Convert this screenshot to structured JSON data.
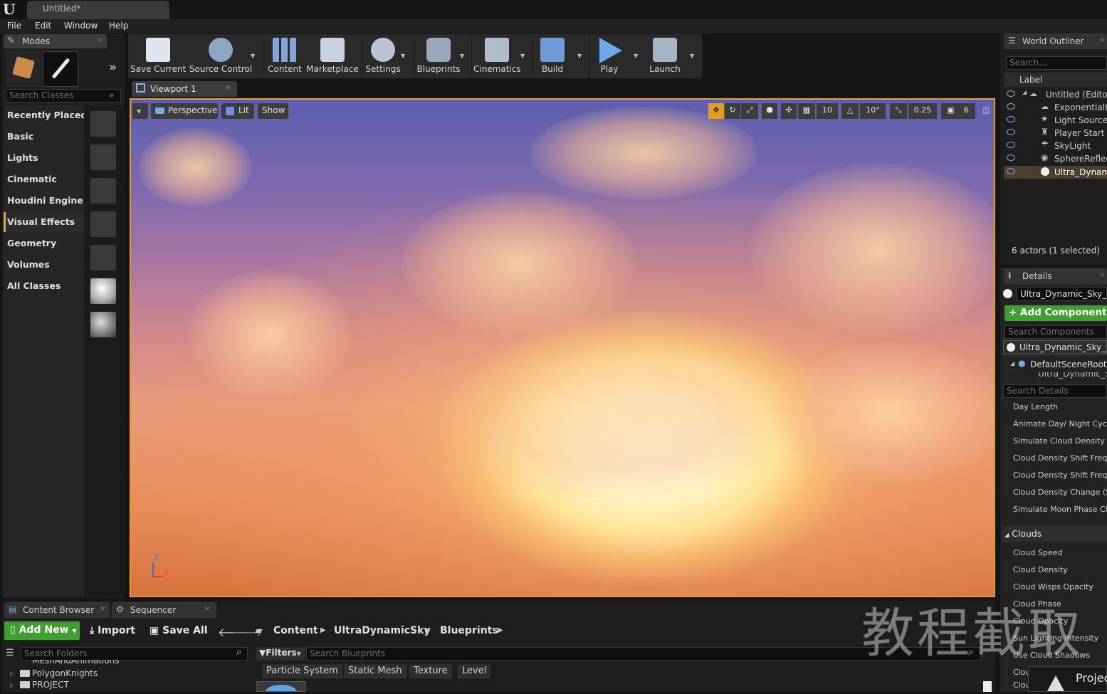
{
  "app": {
    "title": "Untitled*"
  },
  "menu": [
    "File",
    "Edit",
    "Window",
    "Help"
  ],
  "modes": {
    "tab": "Modes",
    "search_placeholder": "Search Classes",
    "categories": [
      "Recently Placed",
      "Basic",
      "Lights",
      "Cinematic",
      "Houdini Engine",
      "Visual Effects",
      "Geometry",
      "Volumes",
      "All Classes"
    ],
    "selected_category": "Visual Effects"
  },
  "toolbar": {
    "buttons": [
      "Save Current",
      "Source Control",
      "Content",
      "Marketplace",
      "Settings",
      "Blueprints",
      "Cinematics",
      "Build",
      "Play",
      "Launch"
    ]
  },
  "viewport": {
    "tab": "Viewport 1",
    "perspective": "Perspective",
    "lit": "Lit",
    "show": "Show",
    "grid_snap": "10",
    "rot_snap": "10°",
    "scale_snap": "0.25",
    "cam_speed": "6",
    "axis_z": "Z",
    "axis_x": "X"
  },
  "outliner": {
    "tab": "World Outliner",
    "search_placeholder": "Search...",
    "col_label": "Label",
    "items": [
      "Untitled (Editor)",
      "ExponentialH",
      "Light Source",
      "Player Start",
      "SkyLight",
      "SphereReflect",
      "Ultra_Dynami"
    ],
    "selected": "Ultra_Dynami",
    "status": "6 actors (1 selected)"
  },
  "details": {
    "tab": "Details",
    "name": "Ultra_Dynamic_Sky_BP",
    "add_component": "+ Add Component",
    "search_components": "Search Components",
    "component_root": "Ultra_Dynamic_Sky_BP",
    "scene_root": "DefaultSceneRoot (I",
    "sub_component": "Ultra_Dynamic_Sk",
    "search_details": "Search Details",
    "props_top": [
      "Day Length",
      "Animate Day/ Night Cycle",
      "Simulate Cloud Density Ch",
      "Cloud Density Shift Freque",
      "Cloud Density Shift Freque",
      "Cloud Density Change (Sm",
      "Simulate Moon Phase Cha"
    ],
    "clouds_header": "Clouds",
    "props_clouds": [
      "Cloud Speed",
      "Cloud Density",
      "Cloud Wisps Opacity",
      "Cloud Phase",
      "Cloud Opacity",
      "Sun Lighting Intensity",
      "Use Cloud Shadows",
      "Clou",
      "Clou"
    ]
  },
  "content_browser": {
    "tabs": [
      "Content Browser",
      "Sequencer"
    ],
    "add_new": "Add New",
    "import": "Import",
    "save_all": "Save All",
    "breadcrumb": [
      "Content",
      "UltraDynamicSky",
      "Blueprints"
    ],
    "search_folders": "Search Folders",
    "filters": "Filters",
    "search_blueprints": "Search Blueprints",
    "filter_chips": [
      "Particle System",
      "Static Mesh",
      "Texture",
      "Level"
    ],
    "folders": [
      "MeshAndAnimations",
      "PolygonKnights",
      "PROJECT"
    ]
  },
  "popup": {
    "text": "Projec"
  },
  "watermark": "教程截取",
  "colors": {
    "accent": "#e59d1f",
    "add_green": "#3f9f2f",
    "eye_blue": "#8ab4e8"
  }
}
